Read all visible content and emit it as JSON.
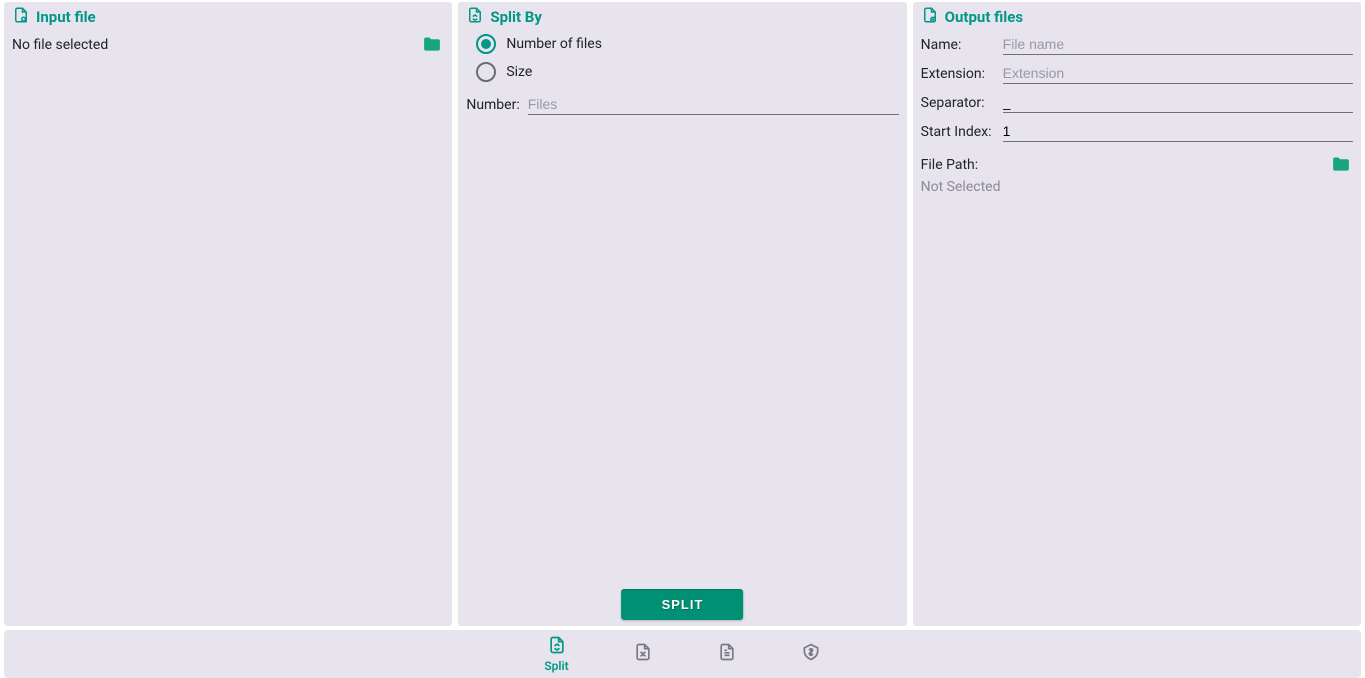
{
  "colors": {
    "accent": "#009688",
    "panel_bg": "#e7e4ee",
    "button_bg": "#009073"
  },
  "input_panel": {
    "title": "Input file",
    "status": "No file selected"
  },
  "split_panel": {
    "title": "Split By",
    "options": {
      "number_of_files": "Number of files",
      "size": "Size"
    },
    "selected": "number_of_files",
    "number_label": "Number:",
    "number_placeholder": "Files",
    "number_value": "",
    "button": "SPLIT"
  },
  "output_panel": {
    "title": "Output files",
    "fields": {
      "name": {
        "label": "Name:",
        "placeholder": "File name",
        "value": ""
      },
      "extension": {
        "label": "Extension:",
        "placeholder": "Extension",
        "value": ""
      },
      "separator": {
        "label": "Separator:",
        "placeholder": "",
        "value": "_"
      },
      "start_index": {
        "label": "Start Index:",
        "placeholder": "",
        "value": "1"
      }
    },
    "file_path_label": "File Path:",
    "file_path_value": "Not Selected"
  },
  "tabs": {
    "split": "Split"
  }
}
